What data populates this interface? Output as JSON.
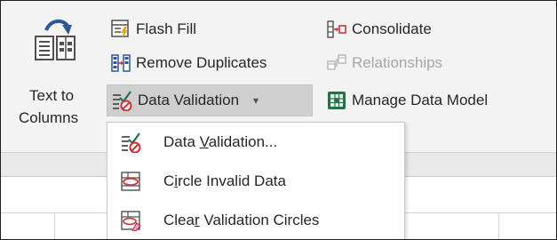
{
  "ribbon": {
    "text_to_columns": {
      "line1": "Text to",
      "line2": "Columns"
    },
    "flash_fill": "Flash Fill",
    "remove_duplicates": "Remove Duplicates",
    "data_validation": "Data Validation",
    "consolidate": "Consolidate",
    "relationships": "Relationships",
    "manage_data_model": "Manage Data Model"
  },
  "menu": {
    "items": [
      {
        "prefix": "Data ",
        "accel": "V",
        "suffix": "alidation...",
        "icon": "data-validation-icon"
      },
      {
        "prefix": "C",
        "accel": "i",
        "suffix": "rcle Invalid Data",
        "icon": "circle-invalid-icon"
      },
      {
        "prefix": "Clea",
        "accel": "r",
        "suffix": " Validation Circles",
        "icon": "clear-circles-icon"
      }
    ]
  },
  "colors": {
    "ribbon_bg": "#f3f3f3",
    "button_pressed": "#cfcfcf",
    "accent_green": "#217346",
    "icon_blue": "#2b579a",
    "icon_red": "#d13438",
    "disabled_text": "#a6a6a6"
  }
}
